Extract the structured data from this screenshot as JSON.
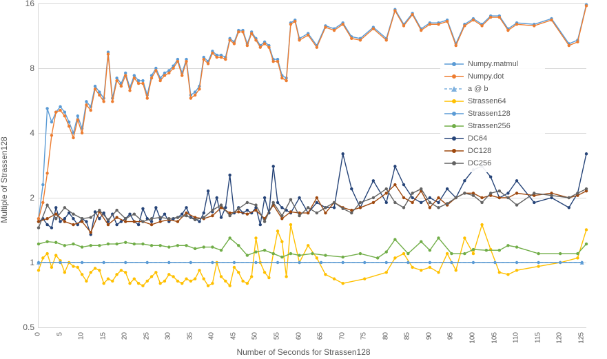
{
  "chart_data": {
    "type": "line",
    "xlabel": "Number of Seconds for Strassen128",
    "ylabel": "Multiple of Strassen128",
    "yscale": "log2",
    "ylim": [
      0.5,
      16
    ],
    "y_ticks": [
      0.5,
      1,
      2,
      4,
      8,
      16
    ],
    "x_ticks": [
      0,
      5,
      10,
      15,
      20,
      25,
      30,
      35,
      40,
      45,
      50,
      55,
      60,
      65,
      70,
      75,
      80,
      85,
      90,
      95,
      100,
      105,
      110,
      115,
      120,
      125
    ],
    "xlim": [
      0,
      126
    ],
    "series": [
      {
        "name": "Numpy.matmul",
        "color": "#5b9bd5",
        "marker": "circle",
        "x": [
          0,
          1,
          2,
          3,
          4,
          5,
          6,
          7,
          8,
          9,
          10,
          11,
          12,
          13,
          14,
          15,
          16,
          17,
          18,
          19,
          20,
          21,
          22,
          23,
          24,
          25,
          26,
          27,
          28,
          29,
          30,
          31,
          32,
          33,
          34,
          35,
          36,
          37,
          38,
          39,
          40,
          41,
          42,
          43,
          44,
          45,
          46,
          47,
          48,
          49,
          50,
          51,
          52,
          53,
          54,
          55,
          56,
          57,
          58,
          59,
          60,
          62,
          64,
          66,
          68,
          70,
          72,
          74,
          77,
          80,
          82,
          84,
          86,
          88,
          90,
          92,
          94,
          96,
          98,
          100,
          102,
          104,
          106,
          108,
          110,
          114,
          118,
          122,
          124,
          126
        ],
        "values": [
          1.6,
          2.3,
          5.2,
          4.5,
          5.0,
          5.3,
          5.0,
          4.5,
          4.0,
          4.8,
          4.2,
          5.6,
          5.3,
          6.6,
          6.2,
          5.8,
          9.5,
          5.8,
          7.2,
          6.8,
          7.6,
          6.5,
          7.4,
          7.0,
          7.0,
          6.0,
          7.4,
          8.0,
          7.2,
          7.6,
          7.8,
          8.2,
          8.8,
          7.6,
          8.8,
          6.0,
          6.2,
          6.6,
          9.0,
          8.6,
          9.6,
          9.2,
          9.2,
          9.0,
          11.0,
          10.6,
          12.0,
          12.0,
          10.4,
          11.8,
          11.0,
          10.2,
          10.6,
          10.2,
          8.8,
          8.8,
          7.4,
          7.2,
          13.0,
          13.4,
          11.0,
          11.6,
          10.2,
          12.6,
          12.2,
          13.0,
          11.2,
          11.0,
          12.4,
          11.0,
          15.0,
          12.8,
          14.4,
          12.2,
          13.0,
          13.0,
          13.4,
          10.4,
          12.8,
          13.6,
          12.8,
          14.0,
          14.0,
          12.2,
          13.0,
          12.8,
          13.6,
          10.4,
          10.8,
          15.8
        ]
      },
      {
        "name": "Numpy.dot",
        "color": "#ed7d31",
        "marker": "circle",
        "x": [
          0,
          1,
          2,
          3,
          4,
          5,
          6,
          7,
          8,
          9,
          10,
          11,
          12,
          13,
          14,
          15,
          16,
          17,
          18,
          19,
          20,
          21,
          22,
          23,
          24,
          25,
          26,
          27,
          28,
          29,
          30,
          31,
          32,
          33,
          34,
          35,
          36,
          37,
          38,
          39,
          40,
          41,
          42,
          43,
          44,
          45,
          46,
          47,
          48,
          49,
          50,
          51,
          52,
          53,
          54,
          55,
          56,
          57,
          58,
          59,
          60,
          62,
          64,
          66,
          68,
          70,
          72,
          74,
          77,
          80,
          82,
          84,
          86,
          88,
          90,
          92,
          94,
          96,
          98,
          100,
          102,
          104,
          106,
          108,
          110,
          114,
          118,
          122,
          124,
          126
        ],
        "values": [
          1.6,
          1.9,
          2.6,
          3.9,
          5.0,
          5.1,
          4.8,
          4.3,
          3.8,
          4.6,
          4.0,
          5.4,
          5.1,
          6.4,
          6.0,
          5.6,
          9.3,
          5.6,
          7.0,
          6.6,
          7.4,
          6.3,
          7.2,
          6.8,
          6.8,
          5.8,
          7.2,
          7.8,
          7.0,
          7.4,
          7.6,
          8.0,
          8.6,
          7.4,
          8.6,
          5.8,
          6.0,
          6.4,
          8.8,
          8.4,
          9.4,
          9.0,
          9.0,
          8.8,
          10.8,
          10.4,
          11.8,
          11.8,
          10.2,
          11.6,
          10.8,
          10.0,
          10.4,
          10.0,
          8.6,
          8.6,
          7.2,
          7.0,
          12.8,
          13.2,
          10.8,
          11.4,
          10.0,
          12.4,
          12.0,
          12.8,
          11.0,
          10.8,
          12.2,
          10.8,
          14.8,
          12.6,
          14.2,
          12.0,
          12.8,
          12.8,
          13.2,
          10.2,
          12.6,
          13.4,
          12.6,
          13.8,
          13.8,
          12.0,
          12.8,
          12.6,
          13.4,
          10.2,
          10.6,
          15.6
        ]
      },
      {
        "name": "a @ b",
        "color": "#7cafdd",
        "marker": "triangle",
        "dash": true,
        "x": [
          0,
          125
        ],
        "values": [
          1.0,
          1.0
        ]
      },
      {
        "name": "Strassen64",
        "color": "#ffc000",
        "marker": "circle",
        "x": [
          0,
          1,
          2,
          3,
          4,
          5,
          6,
          7,
          8,
          9,
          10,
          11,
          12,
          13,
          14,
          15,
          16,
          17,
          18,
          19,
          20,
          21,
          22,
          23,
          24,
          25,
          26,
          27,
          28,
          29,
          30,
          31,
          32,
          33,
          34,
          35,
          36,
          37,
          38,
          39,
          40,
          41,
          42,
          43,
          44,
          45,
          46,
          47,
          48,
          49,
          50,
          51,
          52,
          53,
          54,
          55,
          56,
          57,
          58,
          60,
          62,
          64,
          66,
          68,
          70,
          75,
          80,
          82,
          84,
          86,
          88,
          90,
          92,
          94,
          96,
          98,
          100,
          102,
          104,
          106,
          108,
          110,
          115,
          120,
          124,
          126
        ],
        "values": [
          0.92,
          1.05,
          1.1,
          0.95,
          1.08,
          1.02,
          0.9,
          1.0,
          0.96,
          0.95,
          0.88,
          0.82,
          0.9,
          0.94,
          0.92,
          0.8,
          0.84,
          0.82,
          0.88,
          0.92,
          0.9,
          0.8,
          0.84,
          0.8,
          0.78,
          0.82,
          0.86,
          0.9,
          0.8,
          0.82,
          0.88,
          0.86,
          0.82,
          0.8,
          0.84,
          0.82,
          0.84,
          0.92,
          0.84,
          0.78,
          0.8,
          1.0,
          0.86,
          0.82,
          0.78,
          0.95,
          0.9,
          0.82,
          0.8,
          0.86,
          1.3,
          1.0,
          0.9,
          0.85,
          1.1,
          1.4,
          1.25,
          0.86,
          1.5,
          1.0,
          1.2,
          1.05,
          0.88,
          0.84,
          0.8,
          0.84,
          0.9,
          1.05,
          1.1,
          0.95,
          0.92,
          0.95,
          0.9,
          1.1,
          0.92,
          1.3,
          1.1,
          1.5,
          1.15,
          0.9,
          0.88,
          0.92,
          0.96,
          1.0,
          1.05,
          1.42
        ]
      },
      {
        "name": "Strassen128",
        "color": "#5b9bd5",
        "marker": "circle",
        "x": [
          0,
          5,
          10,
          15,
          20,
          25,
          30,
          35,
          40,
          45,
          50,
          55,
          60,
          65,
          70,
          75,
          80,
          85,
          90,
          95,
          100,
          105,
          110,
          115,
          120,
          125
        ],
        "values": [
          1,
          1,
          1,
          1,
          1,
          1,
          1,
          1,
          1,
          1,
          1,
          1,
          1,
          1,
          1,
          1,
          1,
          1,
          1,
          1,
          1,
          1,
          1,
          1,
          1,
          1
        ]
      },
      {
        "name": "Strassen256",
        "color": "#70ad47",
        "marker": "circle",
        "x": [
          0,
          2,
          4,
          6,
          8,
          10,
          12,
          14,
          16,
          18,
          20,
          22,
          24,
          26,
          28,
          30,
          32,
          34,
          36,
          38,
          40,
          42,
          44,
          46,
          48,
          50,
          52,
          54,
          56,
          58,
          60,
          63,
          66,
          70,
          74,
          78,
          80,
          82,
          85,
          88,
          90,
          92,
          95,
          98,
          100,
          103,
          106,
          108,
          110,
          115,
          120,
          124,
          126
        ],
        "values": [
          1.22,
          1.25,
          1.24,
          1.2,
          1.22,
          1.18,
          1.2,
          1.2,
          1.22,
          1.22,
          1.24,
          1.22,
          1.22,
          1.2,
          1.2,
          1.18,
          1.2,
          1.2,
          1.16,
          1.18,
          1.18,
          1.14,
          1.3,
          1.2,
          1.08,
          1.12,
          1.14,
          1.1,
          1.06,
          1.1,
          1.08,
          1.1,
          1.08,
          1.06,
          1.1,
          1.05,
          1.12,
          1.28,
          1.1,
          1.25,
          1.14,
          1.3,
          1.1,
          1.1,
          1.15,
          1.14,
          1.14,
          1.2,
          1.18,
          1.1,
          1.1,
          1.1,
          1.22
        ]
      },
      {
        "name": "DC64",
        "color": "#264478",
        "marker": "circle",
        "x": [
          0,
          1,
          2,
          3,
          4,
          5,
          6,
          7,
          8,
          9,
          10,
          11,
          12,
          13,
          14,
          15,
          16,
          17,
          18,
          19,
          20,
          21,
          22,
          23,
          24,
          25,
          26,
          27,
          28,
          29,
          30,
          31,
          32,
          33,
          34,
          35,
          36,
          37,
          38,
          39,
          40,
          41,
          42,
          43,
          44,
          45,
          46,
          47,
          48,
          49,
          50,
          51,
          52,
          53,
          54,
          55,
          56,
          57,
          58,
          60,
          62,
          64,
          66,
          68,
          70,
          72,
          74,
          77,
          80,
          82,
          84,
          86,
          88,
          90,
          92,
          94,
          96,
          98,
          100,
          102,
          104,
          106,
          108,
          110,
          114,
          118,
          122,
          124,
          126
        ],
        "values": [
          1.55,
          1.6,
          1.5,
          1.45,
          1.8,
          1.55,
          1.6,
          1.7,
          1.6,
          1.5,
          1.6,
          1.55,
          1.35,
          1.72,
          1.6,
          1.7,
          1.55,
          1.68,
          1.5,
          1.55,
          1.6,
          1.68,
          1.55,
          1.5,
          1.78,
          1.6,
          1.55,
          1.8,
          1.6,
          1.68,
          1.55,
          1.6,
          1.62,
          1.68,
          1.8,
          1.62,
          1.6,
          1.55,
          1.7,
          2.15,
          1.72,
          2.0,
          1.62,
          1.8,
          2.55,
          1.7,
          1.8,
          1.7,
          1.75,
          1.7,
          1.8,
          1.5,
          2.0,
          1.7,
          2.8,
          1.9,
          1.8,
          1.75,
          1.7,
          2.0,
          1.7,
          1.9,
          1.8,
          1.8,
          3.2,
          2.2,
          1.8,
          2.4,
          1.9,
          2.8,
          2.3,
          2.0,
          1.9,
          2.0,
          1.9,
          2.2,
          2.0,
          2.4,
          2.7,
          2.8,
          2.5,
          2.0,
          2.1,
          2.4,
          1.9,
          2.0,
          1.8,
          2.1,
          3.2
        ]
      },
      {
        "name": "DC128",
        "color": "#9e480e",
        "marker": "circle",
        "x": [
          0,
          2,
          4,
          6,
          8,
          10,
          12,
          14,
          16,
          18,
          20,
          22,
          24,
          26,
          28,
          30,
          32,
          34,
          36,
          38,
          40,
          42,
          44,
          46,
          48,
          50,
          52,
          54,
          56,
          58,
          60,
          62,
          64,
          66,
          68,
          70,
          72,
          74,
          77,
          80,
          82,
          84,
          86,
          88,
          90,
          92,
          94,
          96,
          98,
          100,
          102,
          104,
          106,
          108,
          110,
          114,
          118,
          122,
          124,
          126
        ],
        "values": [
          1.55,
          1.6,
          1.68,
          1.55,
          1.5,
          1.55,
          1.38,
          1.72,
          1.5,
          1.62,
          1.55,
          1.55,
          1.55,
          1.5,
          1.55,
          1.58,
          1.55,
          1.7,
          1.62,
          1.6,
          1.65,
          1.8,
          1.7,
          1.72,
          1.68,
          1.75,
          1.6,
          1.85,
          1.6,
          1.72,
          1.7,
          1.7,
          2.0,
          1.7,
          1.9,
          1.8,
          1.75,
          1.8,
          1.9,
          2.1,
          2.3,
          2.0,
          1.9,
          2.15,
          1.8,
          2.0,
          1.85,
          2.0,
          2.1,
          2.1,
          2.0,
          2.05,
          2.0,
          2.0,
          2.1,
          2.05,
          2.1,
          2.0,
          2.05,
          2.15
        ]
      },
      {
        "name": "DC256",
        "color": "#636363",
        "marker": "circle",
        "x": [
          0,
          2,
          4,
          6,
          8,
          10,
          12,
          14,
          16,
          18,
          20,
          22,
          24,
          26,
          28,
          30,
          32,
          34,
          36,
          38,
          40,
          42,
          44,
          46,
          48,
          50,
          52,
          54,
          56,
          58,
          60,
          62,
          64,
          66,
          68,
          70,
          72,
          74,
          77,
          80,
          82,
          84,
          86,
          88,
          90,
          92,
          94,
          96,
          98,
          100,
          102,
          104,
          106,
          108,
          110,
          114,
          118,
          122,
          124,
          126
        ],
        "values": [
          1.45,
          1.85,
          1.6,
          1.8,
          1.68,
          1.6,
          1.62,
          1.75,
          1.58,
          1.75,
          1.6,
          1.68,
          1.55,
          1.6,
          1.62,
          1.6,
          1.62,
          1.65,
          1.58,
          1.62,
          1.75,
          1.85,
          1.65,
          1.78,
          1.9,
          1.85,
          1.55,
          1.9,
          1.65,
          1.96,
          1.65,
          1.8,
          1.7,
          1.8,
          1.9,
          1.78,
          1.7,
          1.9,
          2.0,
          2.2,
          1.9,
          1.8,
          2.1,
          2.2,
          1.9,
          1.8,
          1.88,
          2.0,
          2.1,
          2.05,
          1.9,
          2.1,
          2.15,
          2.0,
          1.85,
          2.1,
          2.05,
          2.0,
          2.1,
          2.2
        ]
      }
    ],
    "legend": {
      "items": [
        {
          "label": "Numpy.matmul",
          "color": "#5b9bd5",
          "marker": "circle"
        },
        {
          "label": "Numpy.dot",
          "color": "#ed7d31",
          "marker": "circle"
        },
        {
          "label": "a @ b",
          "color": "#7cafdd",
          "marker": "triangle",
          "dash": true
        },
        {
          "label": "Strassen64",
          "color": "#ffc000",
          "marker": "circle"
        },
        {
          "label": "Strassen128",
          "color": "#5b9bd5",
          "marker": "circle"
        },
        {
          "label": "Strassen256",
          "color": "#70ad47",
          "marker": "circle"
        },
        {
          "label": "DC64",
          "color": "#264478",
          "marker": "circle"
        },
        {
          "label": "DC128",
          "color": "#9e480e",
          "marker": "circle"
        },
        {
          "label": "DC256",
          "color": "#636363",
          "marker": "circle"
        }
      ]
    }
  }
}
